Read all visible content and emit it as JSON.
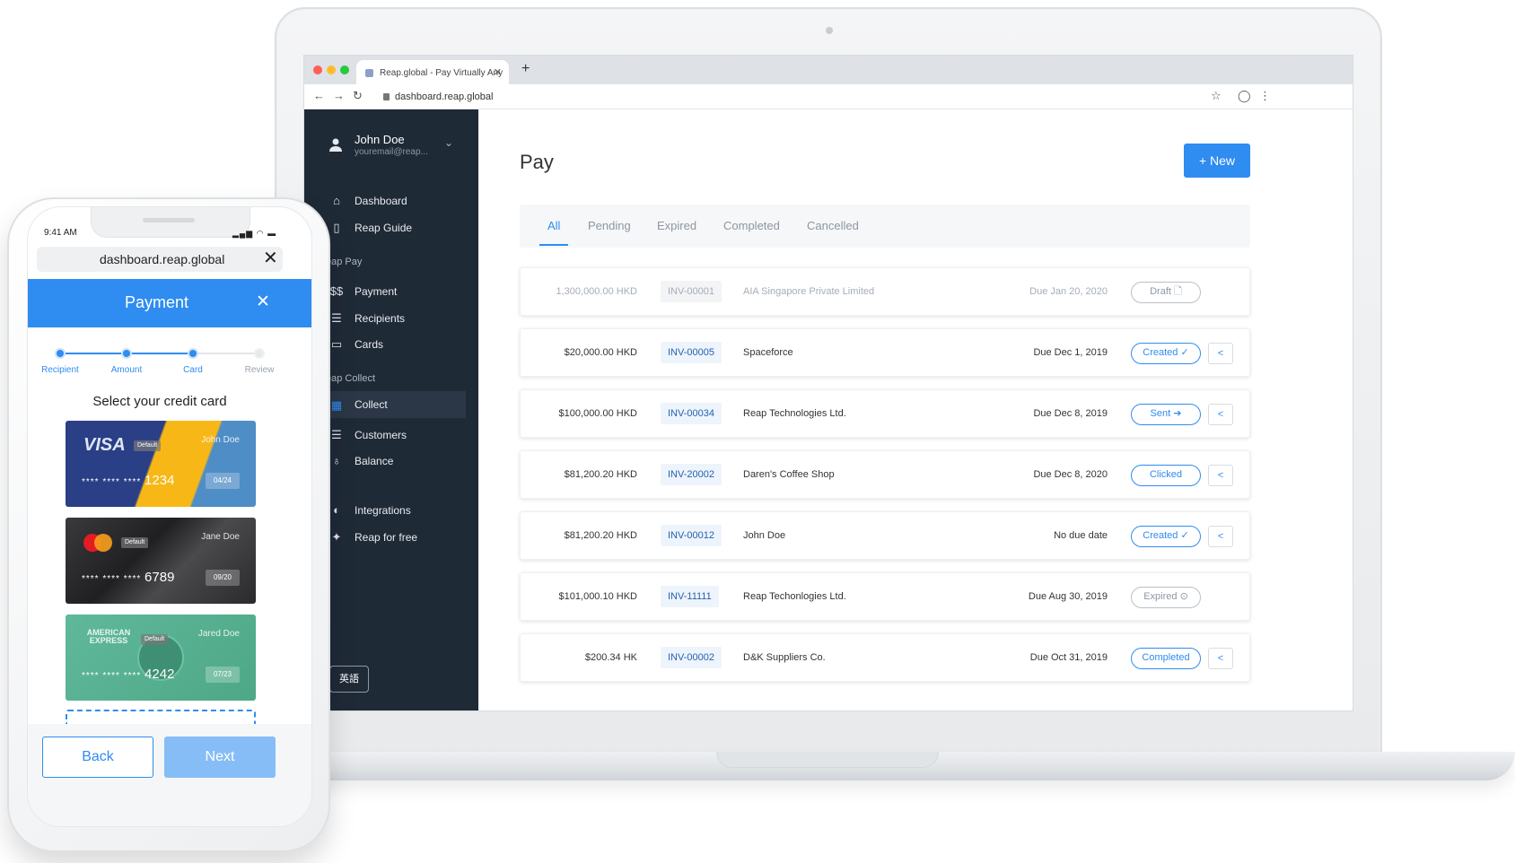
{
  "browser": {
    "tab_title": "Reap.global - Pay Virtually Any",
    "url": "dashboard.reap.global"
  },
  "sidebar": {
    "user_name": "John Doe",
    "user_email": "youremail@reap...",
    "items": [
      {
        "label": "Dashboard",
        "icon": "home-icon"
      },
      {
        "label": "Reap Guide",
        "icon": "book-icon"
      },
      {
        "label": "Payment",
        "icon": "dollar-icon"
      },
      {
        "label": "Recipients",
        "icon": "list-icon"
      },
      {
        "label": "Cards",
        "icon": "card-icon"
      },
      {
        "label": "Collect",
        "icon": "collect-icon"
      },
      {
        "label": "Customers",
        "icon": "list-icon"
      },
      {
        "label": "Balance",
        "icon": "bag-icon"
      },
      {
        "label": "Integrations",
        "icon": "plug-icon"
      },
      {
        "label": "Reap for free",
        "icon": "sparkle-icon"
      }
    ],
    "section_pay": "eap Pay",
    "section_collect": "eap Collect",
    "lang_button": "英語"
  },
  "main": {
    "title": "Pay",
    "new_button": "+ New",
    "tabs": [
      "All",
      "Pending",
      "Expired",
      "Completed",
      "Cancelled"
    ],
    "active_tab": "All",
    "rows": [
      {
        "amount": "1,300,000.00 HKD",
        "invoice": "INV-00001",
        "name": "AIA Singapore Private Limited",
        "due": "Due Jan 20, 2020",
        "status": "Draft",
        "status_icon": "🗋",
        "faded": true,
        "share": false
      },
      {
        "amount": "$20,000.00 HKD",
        "invoice": "INV-00005",
        "name": "Spaceforce",
        "due": "Due Dec 1, 2019",
        "status": "Created",
        "status_icon": "✓",
        "faded": false,
        "share": true
      },
      {
        "amount": "$100,000.00 HKD",
        "invoice": "INV-00034",
        "name": "Reap Technologies Ltd.",
        "due": "Due Dec 8, 2019",
        "status": "Sent",
        "status_icon": "➔",
        "faded": false,
        "share": true
      },
      {
        "amount": "$81,200.20 HKD",
        "invoice": "INV-20002",
        "name": "Daren's Coffee Shop",
        "due": "Due Dec 8, 2020",
        "status": "Clicked",
        "status_icon": "",
        "faded": false,
        "share": true
      },
      {
        "amount": "$81,200.20 HKD",
        "invoice": "INV-00012",
        "name": "John Doe",
        "due": "No due date",
        "status": "Created",
        "status_icon": "✓",
        "faded": false,
        "share": true
      },
      {
        "amount": "$101,000.10 HKD",
        "invoice": "INV-11111",
        "name": "Reap Techonlogies Ltd.",
        "due": "Due Aug 30, 2019",
        "status": "Expired",
        "status_icon": "⊙",
        "faded": false,
        "share": false
      },
      {
        "amount": "$200.34 HK",
        "invoice": "INV-00002",
        "name": "D&K Suppliers Co.",
        "due": "Due Oct 31, 2019",
        "status": "Completed",
        "status_icon": "",
        "faded": false,
        "share": true
      }
    ]
  },
  "phone": {
    "time": "9:41 AM",
    "url": "dashboard.reap.global",
    "header_title": "Payment",
    "steps": [
      {
        "label": "Recipient",
        "done": true
      },
      {
        "label": "Amount",
        "done": true
      },
      {
        "label": "Card",
        "done": true
      },
      {
        "label": "Review",
        "done": false
      }
    ],
    "select_label": "Select your credit card",
    "cards": [
      {
        "brand": "VISA",
        "holder": "John Doe",
        "masked": "**** **** ****",
        "last4": "1234",
        "expiry": "04/24",
        "badge": "Default"
      },
      {
        "brand": "mastercard",
        "holder": "Jane Doe",
        "masked": "**** **** ****",
        "last4": "6789",
        "expiry": "09/20",
        "badge": "Default"
      },
      {
        "brand": "AMERICAN EXPRESS",
        "holder": "Jared Doe",
        "masked": "**** **** ****",
        "last4": "4242",
        "expiry": "07/23",
        "badge": "Default"
      }
    ],
    "back_button": "Back",
    "next_button": "Next"
  },
  "colors": {
    "accent": "#2f8cf0",
    "sidebar": "#1f2a37",
    "visa_yellow": "#f7b817",
    "amex_green": "#5fb89a"
  }
}
